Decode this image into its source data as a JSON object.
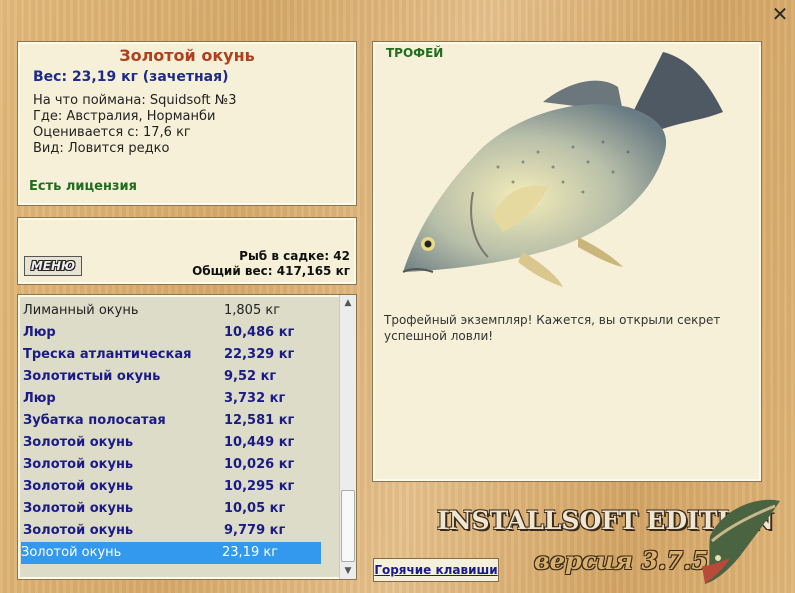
{
  "window": {
    "close_glyph": "✕"
  },
  "info": {
    "title": "Золотой окунь",
    "weight": "Вес: 23,19 кг (зачетная)",
    "caught_on": "На что поймана: Squidsoft №3",
    "location": "Где: Австралия, Норманби",
    "valued_from": "Оценивается с: 17,6 кг",
    "kind": "Вид: Ловится редко",
    "license": "Есть лицензия"
  },
  "keepnet": {
    "menu_label": "МЕНЮ",
    "fish_count": "Рыб в садке: 42",
    "total_weight": "Общий вес: 417,165 кг"
  },
  "catch_list": [
    {
      "name": "Лиманный окунь",
      "weight": "1,805 кг",
      "style": "normal"
    },
    {
      "name": "Люр",
      "weight": "10,486 кг",
      "style": "bold"
    },
    {
      "name": "Треска атлантическая",
      "weight": "22,329 кг",
      "style": "bold"
    },
    {
      "name": "Золотистый окунь",
      "weight": "9,52 кг",
      "style": "bold"
    },
    {
      "name": "Люр",
      "weight": "3,732 кг",
      "style": "bold"
    },
    {
      "name": "Зубатка полосатая",
      "weight": "12,581 кг",
      "style": "bold"
    },
    {
      "name": "Золотой окунь",
      "weight": "10,449 кг",
      "style": "bold"
    },
    {
      "name": "Золотой окунь",
      "weight": "10,026 кг",
      "style": "bold"
    },
    {
      "name": "Золотой окунь",
      "weight": "10,295 кг",
      "style": "bold"
    },
    {
      "name": "Золотой окунь",
      "weight": "10,05 кг",
      "style": "bold"
    },
    {
      "name": "Золотой окунь",
      "weight": "9,779 кг",
      "style": "bold"
    },
    {
      "name": "Золотой окунь",
      "weight": "23,19 кг",
      "style": "sel"
    }
  ],
  "trophy": {
    "label": "ТРОФЕЙ",
    "description": "Трофейный экземпляр! Кажется, вы открыли секрет успешной ловли!"
  },
  "footer": {
    "hotkeys_label": "Горячие клавиши",
    "edition": "INSTALLSOFT EDITION",
    "version": "версия 3.7.5"
  },
  "colors": {
    "title": "#b0401e",
    "bold_row": "#1b1b88",
    "license": "#206d20",
    "selection": "#3399ee"
  }
}
